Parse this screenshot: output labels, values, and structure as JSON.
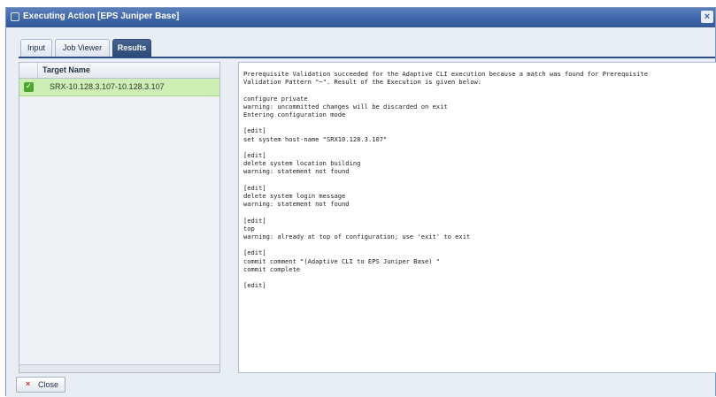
{
  "window": {
    "title": "Executing Action [EPS Juniper Base]"
  },
  "tabs": [
    {
      "label": "Input",
      "active": false
    },
    {
      "label": "Job Viewer",
      "active": false
    },
    {
      "label": "Results",
      "active": true
    }
  ],
  "targets": {
    "column_header": "Target Name",
    "rows": [
      {
        "name": "SRX-10.128.3.107-10.128.3.107",
        "status": "success",
        "selected": true
      }
    ]
  },
  "results": {
    "output": "Prerequisite Validation succeeded for the Adaptive CLI execution because a match was found for Prerequisite\nValidation Pattern \"~\". Result of the Execution is given below:\n\nconfigure private\nwarning: uncommitted changes will be discarded on exit\nEntering configuration mode\n\n[edit]\nset system host-name \"SRX10.128.3.107\"\n\n[edit]\ndelete system location building\nwarning: statement not found\n\n[edit]\ndelete system login message\nwarning: statement not found\n\n[edit]\ntop\nwarning: already at top of configuration; use 'exit' to exit\n\n[edit]\ncommit comment \"(Adaptive CLI to EPS Juniper Base) \"\ncommit complete\n\n[edit]"
  },
  "footer": {
    "close_label": "Close"
  },
  "colors": {
    "titlebar": "#3f66a8",
    "selected_row": "#cdeeb4",
    "success_icon": "#4aa62e",
    "active_tab": "#2c4a78"
  }
}
